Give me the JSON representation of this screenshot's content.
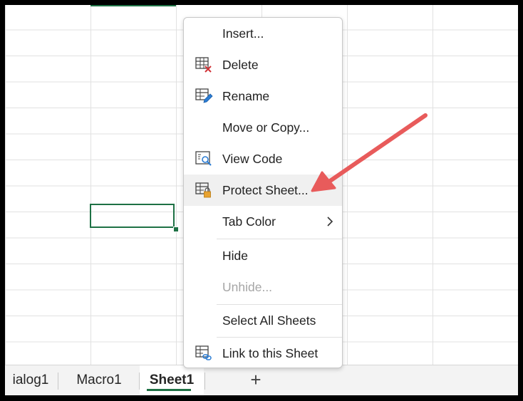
{
  "context_menu": {
    "items": [
      {
        "label": "Insert...",
        "icon": "none",
        "enabled": true
      },
      {
        "label": "Delete",
        "icon": "delete-sheet-icon",
        "enabled": true
      },
      {
        "label": "Rename",
        "icon": "rename-sheet-icon",
        "enabled": true
      },
      {
        "label": "Move or Copy...",
        "icon": "none",
        "enabled": true
      },
      {
        "label": "View Code",
        "icon": "view-code-icon",
        "enabled": true
      },
      {
        "label": "Protect Sheet...",
        "icon": "protect-sheet-icon",
        "enabled": true,
        "highlighted": true
      },
      {
        "label": "Tab Color",
        "icon": "none",
        "enabled": true,
        "submenu": true
      },
      {
        "label": "Hide",
        "icon": "none",
        "enabled": true
      },
      {
        "label": "Unhide...",
        "icon": "none",
        "enabled": false
      },
      {
        "label": "Select All Sheets",
        "icon": "none",
        "enabled": true
      },
      {
        "label": "Link to this Sheet",
        "icon": "link-sheet-icon",
        "enabled": true
      }
    ]
  },
  "sheet_tabs": {
    "tabs": [
      {
        "label": "ialog1",
        "active": false
      },
      {
        "label": "Macro1",
        "active": false
      },
      {
        "label": "Sheet1",
        "active": true
      }
    ],
    "add_label": "+"
  },
  "colors": {
    "excel_green": "#1e7145",
    "annotation_arrow": "#e85b5b",
    "lock_orange": "#e8a230",
    "delete_red": "#d13438",
    "pencil_blue": "#2b7cd3"
  }
}
